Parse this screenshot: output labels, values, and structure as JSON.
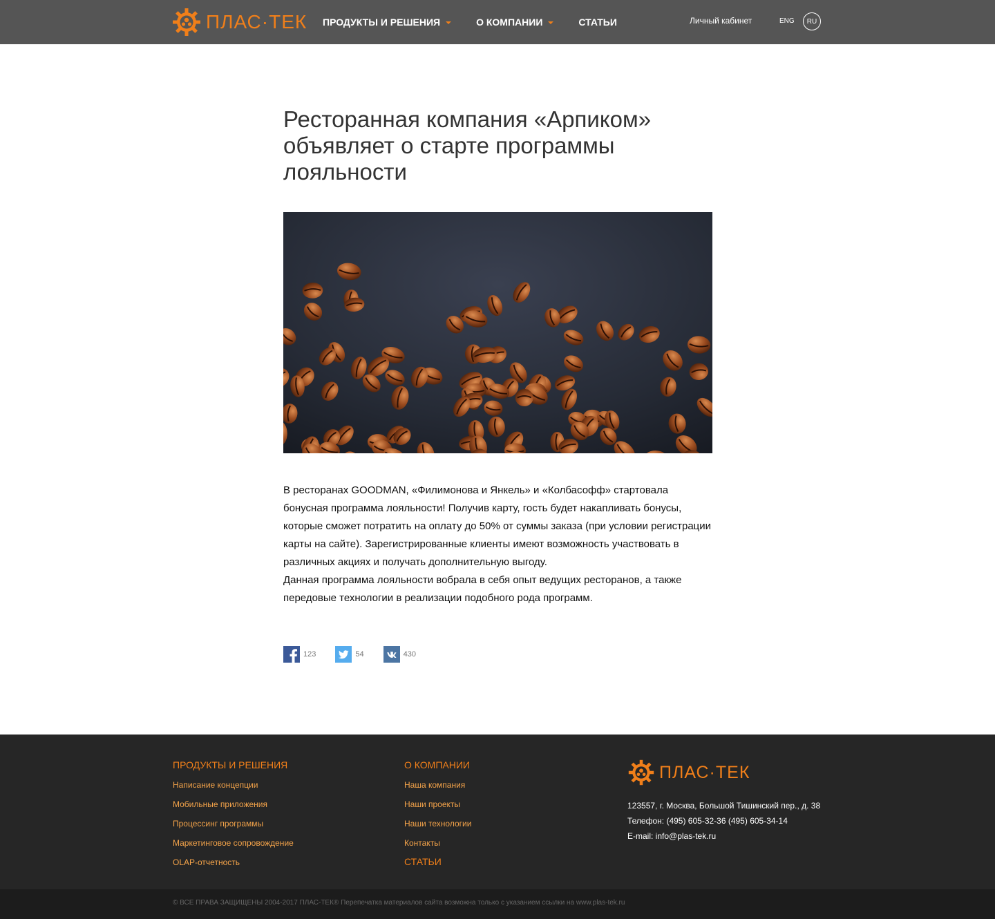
{
  "header": {
    "logo_text": "ПЛАС·ТЕК",
    "nav": [
      {
        "label": "ПРОДУКТЫ И РЕШЕНИЯ",
        "dropdown": true
      },
      {
        "label": "О КОМПАНИИ",
        "dropdown": true
      },
      {
        "label": "СТАТЬИ",
        "dropdown": false
      }
    ],
    "cabinet": "Личный кабинет",
    "lang_eng": "ENG",
    "lang_ru": "RU"
  },
  "article": {
    "title": "Ресторанная компания «Арпиком» объявляет о старте программы лояльности",
    "paragraphs": [
      "В ресторанах GOODMAN, «Филимонова и Янкель» и «Колбасофф» стартовала бонусная программа лояльности! Получив карту, гость будет накапливать бонусы, которые сможет потратить на оплату до 50% от суммы заказа (при условии регистрации карты на сайте). Зарегистрированные клиенты имеют возможность участвовать в различных акциях и получать дополнительную выгоду.",
      "Данная программа лояльности вобрала в себя опыт ведущих ресторанов, а также передовые технологии в реализации подобного рода программ."
    ],
    "share": {
      "facebook": "123",
      "twitter": "54",
      "vk": "430"
    }
  },
  "footer": {
    "products": {
      "heading": "ПРОДУКТЫ И РЕШЕНИЯ",
      "links": [
        "Написание концепции",
        "Мобильные приложения",
        "Процессинг программы",
        "Маркетинговое сопровождение",
        "OLAP-отчетность"
      ]
    },
    "company": {
      "heading": "О КОМПАНИИ",
      "links": [
        "Наша компания",
        "Наши проекты",
        "Наши технологии",
        "Контакты"
      ],
      "articles": "СТАТЬИ"
    },
    "logo_text": "ПЛАС·ТЕК",
    "address": "123557, г. Москва, Большой Тишинский пер., д. 38",
    "phone": "Телефон: (495) 605-32-36 (495) 605-34-14",
    "email": "E-mail: info@plas-tek.ru",
    "copyright": "© ВСЕ ПРАВА ЗАЩИЩЕНЫ 2004-2017 ПЛАС-ТЕК®  Перепечатка материалов сайта возможна только с указанием ссылки на www.plas-tek.ru"
  },
  "colors": {
    "accent": "#f07f1a",
    "header_bg": "#555555",
    "footer_bg": "#262626"
  }
}
